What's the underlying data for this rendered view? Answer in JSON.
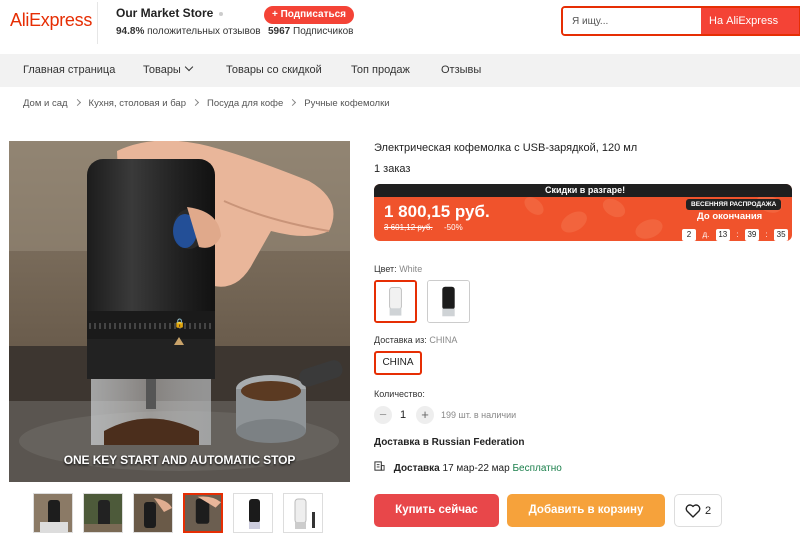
{
  "header": {
    "logo": "AliExpress",
    "store_name": "Our Market Store",
    "positive_pct": "94.8%",
    "positive_label": "положительных отзывов",
    "subscribe_label": "+ Подписаться",
    "subscribers_count": "5967",
    "subscribers_label": "Подписчиков",
    "search_placeholder": "Я ищу...",
    "search_button": "На AliExpress"
  },
  "nav": {
    "items": [
      "Главная страница",
      "Товары",
      "Товары со скидкой",
      "Топ продаж",
      "Отзывы"
    ]
  },
  "breadcrumb": [
    "Дом и сад",
    "Кухня, столовая и бар",
    "Посуда для кофе",
    "Ручные кофемолки"
  ],
  "gallery": {
    "caption": "ONE KEY START AND AUTOMATIC STOP",
    "thumbnail_count": 6,
    "active_thumbnail": 4
  },
  "product": {
    "title": "Электрическая кофемолка с USB-зарядкой, 120 мл",
    "orders": "1 заказ",
    "sale_banner": {
      "headline": "Скидки в разгаре!",
      "price": "1 800,15 руб.",
      "old_price": "3 601,12 руб.",
      "discount": "-50%",
      "event_badge": "ВЕСЕННЯЯ РАСПРОДАЖА",
      "until_label": "До окончания",
      "countdown": {
        "days": "2",
        "days_unit": "д.",
        "hours": "13",
        "minutes": "39",
        "seconds": "35"
      }
    },
    "color_label": "Цвет:",
    "color_value": "White",
    "ship_from_label": "Доставка из:",
    "ship_from_value": "CHINA",
    "ship_option": "CHINA",
    "quantity_label": "Количество:",
    "quantity_minus": "−",
    "quantity_plus": "+",
    "quantity": "1",
    "stock": "199 шт. в наличии",
    "delivery_to": "Доставка в Russian Federation",
    "delivery_label": "Доставка",
    "delivery_dates": "17 мар-22 мар",
    "delivery_price": "Бесплатно",
    "buy_now": "Купить сейчас",
    "add_to_cart": "Добавить в корзину",
    "wishlist_count": "2"
  },
  "colors": {
    "accent": "#e62e04",
    "sale_banner": "#f0532c",
    "buy_button": "#e8474a",
    "cart_button": "#f6a23b",
    "free_delivery": "#1a7f4b"
  }
}
